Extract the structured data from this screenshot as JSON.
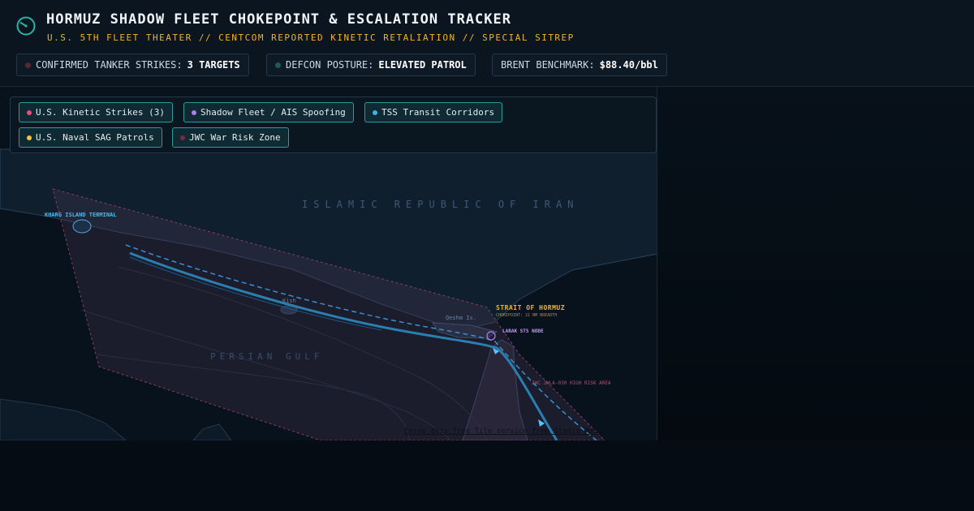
{
  "header": {
    "title": "HORMUZ SHADOW FLEET CHOKEPOINT & ESCALATION TRACKER",
    "subtitle": "U.S. 5TH FLEET THEATER // CENTCOM REPORTED KINETIC RETALIATION // SPECIAL SITREP",
    "logo_icon": "gauge-icon"
  },
  "stats": [
    {
      "label": "CONFIRMED TANKER STRIKES:",
      "value": "3 TARGETS",
      "dot_color": "#5a2634"
    },
    {
      "label": "DEFCON POSTURE:",
      "value": "ELEVATED PATROL",
      "dot_color": "#1f5a57"
    },
    {
      "label": "BRENT BENCHMARK:",
      "value": "$88.40/bbl"
    }
  ],
  "legend": [
    {
      "label": "U.S. Kinetic Strikes (3)",
      "color": "#ef4b7f"
    },
    {
      "label": "Shadow Fleet / AIS Spoofing",
      "color": "#b07cf0"
    },
    {
      "label": "TSS Transit Corridors",
      "color": "#38b6e8"
    },
    {
      "label": "U.S. Naval SAG Patrols",
      "color": "#f5c542"
    },
    {
      "label": "JWC War Risk Zone",
      "color": "#7a2a45"
    }
  ],
  "map": {
    "region_iran": "ISLAMIC REPUBLIC OF IRAN",
    "region_gulf": "PERSIAN GULF",
    "kharg_label": "KHARG ISLAND TERMINAL",
    "kish_label": "Kish",
    "qeshm_label": "Qeshm Is.",
    "strait_title": "STRAIT OF HORMUZ",
    "strait_sub": "CHOKEPOINT: 21 NM BREADTH",
    "larak_label": "LARAK STS NODE",
    "jwc_label": "JWC JWLA-030 HIGH RISK AREA",
    "credit": "Enjoy this free Tile service from Stadia Maps"
  },
  "colors": {
    "accent": "#f0b429",
    "teal": "#2a9d9a",
    "corridor": "#2f8fc4",
    "risk_zone_border": "#8a3f5c"
  }
}
